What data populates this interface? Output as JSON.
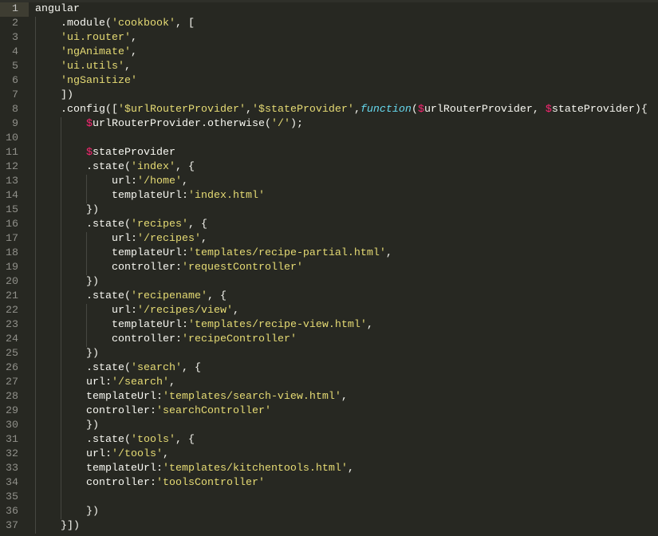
{
  "editor": {
    "current_line": 1,
    "theme_colors": {
      "background": "#272822",
      "plain": "#f8f8f2",
      "string": "#e6db74",
      "dollar": "#f92672",
      "function": "#66d9ef",
      "gutter_highlight": "#3e3d32"
    },
    "lines": [
      [
        [
          "plain",
          "angular"
        ]
      ],
      [
        [
          "plain",
          "    .module("
        ],
        [
          "str",
          "'cookbook'"
        ],
        [
          "plain",
          ", ["
        ]
      ],
      [
        [
          "plain",
          "    "
        ],
        [
          "str",
          "'ui.router'"
        ],
        [
          "plain",
          ","
        ]
      ],
      [
        [
          "plain",
          "    "
        ],
        [
          "str",
          "'ngAnimate'"
        ],
        [
          "plain",
          ","
        ]
      ],
      [
        [
          "plain",
          "    "
        ],
        [
          "str",
          "'ui.utils'"
        ],
        [
          "plain",
          ","
        ]
      ],
      [
        [
          "plain",
          "    "
        ],
        [
          "str",
          "'ngSanitize'"
        ]
      ],
      [
        [
          "plain",
          "    ])"
        ]
      ],
      [
        [
          "plain",
          "    .config(["
        ],
        [
          "str",
          "'$urlRouterProvider'"
        ],
        [
          "plain",
          ","
        ],
        [
          "str",
          "'$stateProvider'"
        ],
        [
          "plain",
          ","
        ],
        [
          "fn",
          "function"
        ],
        [
          "plain",
          "("
        ],
        [
          "dollar",
          "$"
        ],
        [
          "plain",
          "urlRouterProvider, "
        ],
        [
          "dollar",
          "$"
        ],
        [
          "plain",
          "stateProvider){"
        ]
      ],
      [
        [
          "plain",
          "        "
        ],
        [
          "dollar",
          "$"
        ],
        [
          "plain",
          "urlRouterProvider.otherwise("
        ],
        [
          "str",
          "'/'"
        ],
        [
          "plain",
          ");"
        ]
      ],
      [],
      [
        [
          "plain",
          "        "
        ],
        [
          "dollar",
          "$"
        ],
        [
          "plain",
          "stateProvider"
        ]
      ],
      [
        [
          "plain",
          "        .state("
        ],
        [
          "str",
          "'index'"
        ],
        [
          "plain",
          ", {"
        ]
      ],
      [
        [
          "plain",
          "            url:"
        ],
        [
          "str",
          "'/home'"
        ],
        [
          "plain",
          ","
        ]
      ],
      [
        [
          "plain",
          "            templateUrl:"
        ],
        [
          "str",
          "'index.html'"
        ]
      ],
      [
        [
          "plain",
          "        })"
        ]
      ],
      [
        [
          "plain",
          "        .state("
        ],
        [
          "str",
          "'recipes'"
        ],
        [
          "plain",
          ", {"
        ]
      ],
      [
        [
          "plain",
          "            url:"
        ],
        [
          "str",
          "'/recipes'"
        ],
        [
          "plain",
          ","
        ]
      ],
      [
        [
          "plain",
          "            templateUrl:"
        ],
        [
          "str",
          "'templates/recipe-partial.html'"
        ],
        [
          "plain",
          ","
        ]
      ],
      [
        [
          "plain",
          "            controller:"
        ],
        [
          "str",
          "'requestController'"
        ]
      ],
      [
        [
          "plain",
          "        })"
        ]
      ],
      [
        [
          "plain",
          "        .state("
        ],
        [
          "str",
          "'recipename'"
        ],
        [
          "plain",
          ", {"
        ]
      ],
      [
        [
          "plain",
          "            url:"
        ],
        [
          "str",
          "'/recipes/view'"
        ],
        [
          "plain",
          ","
        ]
      ],
      [
        [
          "plain",
          "            templateUrl:"
        ],
        [
          "str",
          "'templates/recipe-view.html'"
        ],
        [
          "plain",
          ","
        ]
      ],
      [
        [
          "plain",
          "            controller:"
        ],
        [
          "str",
          "'recipeController'"
        ]
      ],
      [
        [
          "plain",
          "        })"
        ]
      ],
      [
        [
          "plain",
          "        .state("
        ],
        [
          "str",
          "'search'"
        ],
        [
          "plain",
          ", {"
        ]
      ],
      [
        [
          "plain",
          "        url:"
        ],
        [
          "str",
          "'/search'"
        ],
        [
          "plain",
          ","
        ]
      ],
      [
        [
          "plain",
          "        templateUrl:"
        ],
        [
          "str",
          "'templates/search-view.html'"
        ],
        [
          "plain",
          ","
        ]
      ],
      [
        [
          "plain",
          "        controller:"
        ],
        [
          "str",
          "'searchController'"
        ]
      ],
      [
        [
          "plain",
          "        })"
        ]
      ],
      [
        [
          "plain",
          "        .state("
        ],
        [
          "str",
          "'tools'"
        ],
        [
          "plain",
          ", {"
        ]
      ],
      [
        [
          "plain",
          "        url:"
        ],
        [
          "str",
          "'/tools'"
        ],
        [
          "plain",
          ","
        ]
      ],
      [
        [
          "plain",
          "        templateUrl:"
        ],
        [
          "str",
          "'templates/kitchentools.html'"
        ],
        [
          "plain",
          ","
        ]
      ],
      [
        [
          "plain",
          "        controller:"
        ],
        [
          "str",
          "'toolsController'"
        ]
      ],
      [],
      [
        [
          "plain",
          "        })"
        ]
      ],
      [
        [
          "plain",
          "    }])"
        ]
      ]
    ]
  }
}
